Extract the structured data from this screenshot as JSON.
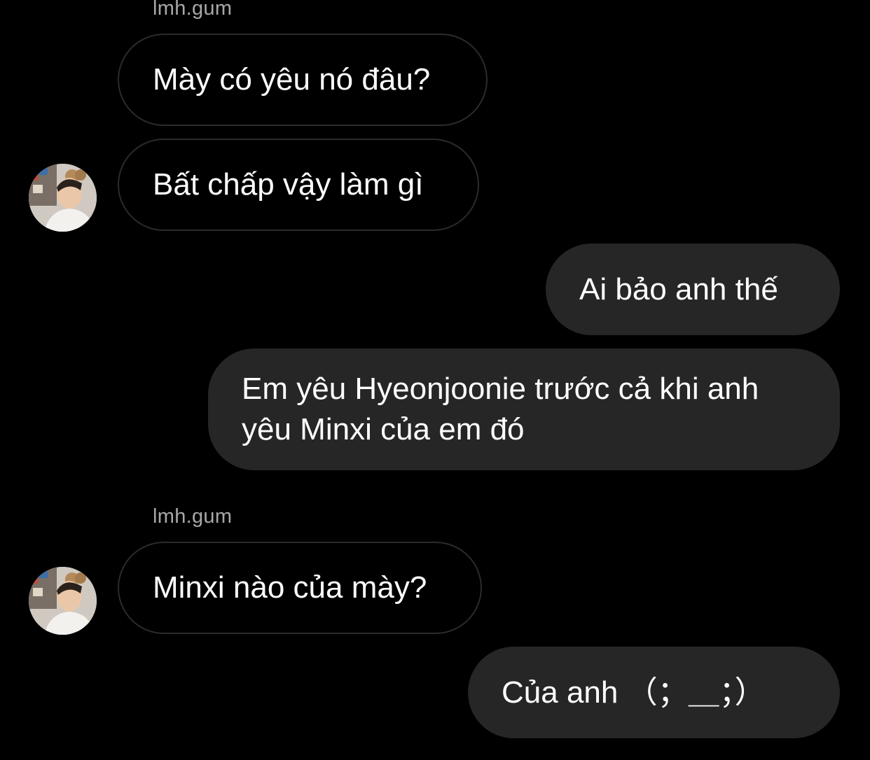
{
  "messages": {
    "group1_sender": "lmh.gum",
    "msg1": "Mày có yêu nó đâu?",
    "msg2": "Bất chấp vậy làm gì",
    "msg3": "Ai bảo anh thế",
    "msg4": "Em yêu Hyeonjoonie trước cả khi anh yêu Minxi của em đó",
    "group2_sender": "lmh.gum",
    "msg5": "Minxi nào của mày?",
    "msg6": "Của anh （；＿；）"
  },
  "colors": {
    "background": "#000000",
    "incoming_border": "#2b2b2b",
    "outgoing_bubble": "#262626",
    "sender_name": "#a8a8a8",
    "text": "#ffffff"
  },
  "icons": {
    "avatar": "profile-photo-avatar"
  }
}
